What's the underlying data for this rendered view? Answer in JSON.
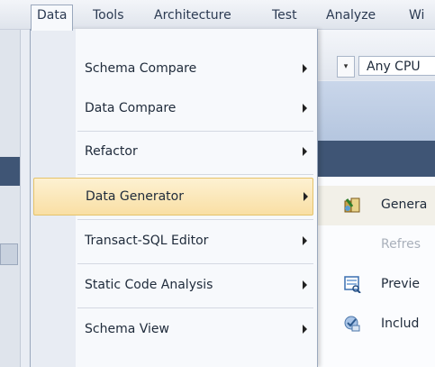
{
  "menubar": {
    "items": [
      "Data",
      "Tools",
      "Architecture",
      "Test",
      "Analyze",
      "Wi"
    ],
    "active": "Data"
  },
  "toolbar": {
    "config_value": "Any CPU",
    "dropdown_glyph": "▾"
  },
  "data_menu": {
    "items": [
      {
        "label": "Schema Compare"
      },
      {
        "label": "Data Compare"
      },
      {
        "label": "Refactor"
      },
      {
        "label": "Data Generator"
      },
      {
        "label": "Transact-SQL Editor"
      },
      {
        "label": "Static Code Analysis"
      },
      {
        "label": "Schema View"
      }
    ]
  },
  "data_generator_submenu": {
    "items": [
      {
        "label": "Genera",
        "icon": "data-generate-icon",
        "enabled": true
      },
      {
        "label": "Refres",
        "icon": "",
        "enabled": false
      },
      {
        "label": "Previe",
        "icon": "preview-icon",
        "enabled": true
      },
      {
        "label": "Includ",
        "icon": "include-icon",
        "enabled": true
      }
    ]
  },
  "colors": {
    "highlight": "#f9dfa4",
    "menu_background": "#f7f9fc",
    "dark_bar": "#3f5575"
  }
}
